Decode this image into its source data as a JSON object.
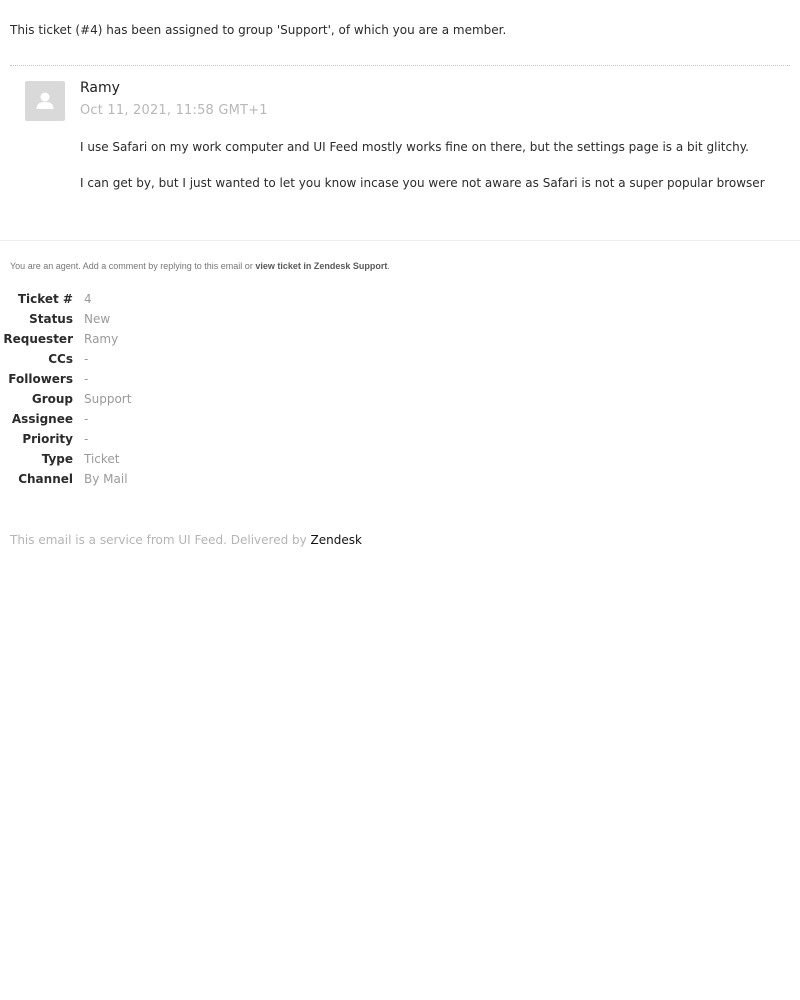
{
  "intro_text": "This ticket (#4) has been assigned to group 'Support', of which you are a member.",
  "comment": {
    "author": "Ramy",
    "date": "Oct 11, 2021, 11:58 GMT+1",
    "paragraphs": [
      "I use Safari on my work computer and UI Feed mostly works fine on there, but the settings page is a bit glitchy.",
      "I can get by, but I just wanted to let you know incase you were not aware as Safari is not a super popular browser"
    ],
    "avatar_icon": "user-placeholder-icon"
  },
  "agent_note": {
    "prefix": "You are an agent. Add a comment by replying to this email or ",
    "link_text": "view ticket in Zendesk Support",
    "suffix": "."
  },
  "properties": [
    {
      "label": "Ticket #",
      "value": "4"
    },
    {
      "label": "Status",
      "value": "New"
    },
    {
      "label": "Requester",
      "value": "Ramy"
    },
    {
      "label": "CCs",
      "value": "-"
    },
    {
      "label": "Followers",
      "value": "-"
    },
    {
      "label": "Group",
      "value": "Support"
    },
    {
      "label": "Assignee",
      "value": "-"
    },
    {
      "label": "Priority",
      "value": "-"
    },
    {
      "label": "Type",
      "value": "Ticket"
    },
    {
      "label": "Channel",
      "value": "By Mail"
    }
  ],
  "footer": {
    "text": "This email is a service from UI Feed. Delivered by ",
    "link_text": "Zendesk"
  },
  "colors": {
    "text": "#2b2b2b",
    "muted": "#9a9a9a",
    "date": "#b8b8b8",
    "avatar_bg": "#d9d9d9"
  }
}
